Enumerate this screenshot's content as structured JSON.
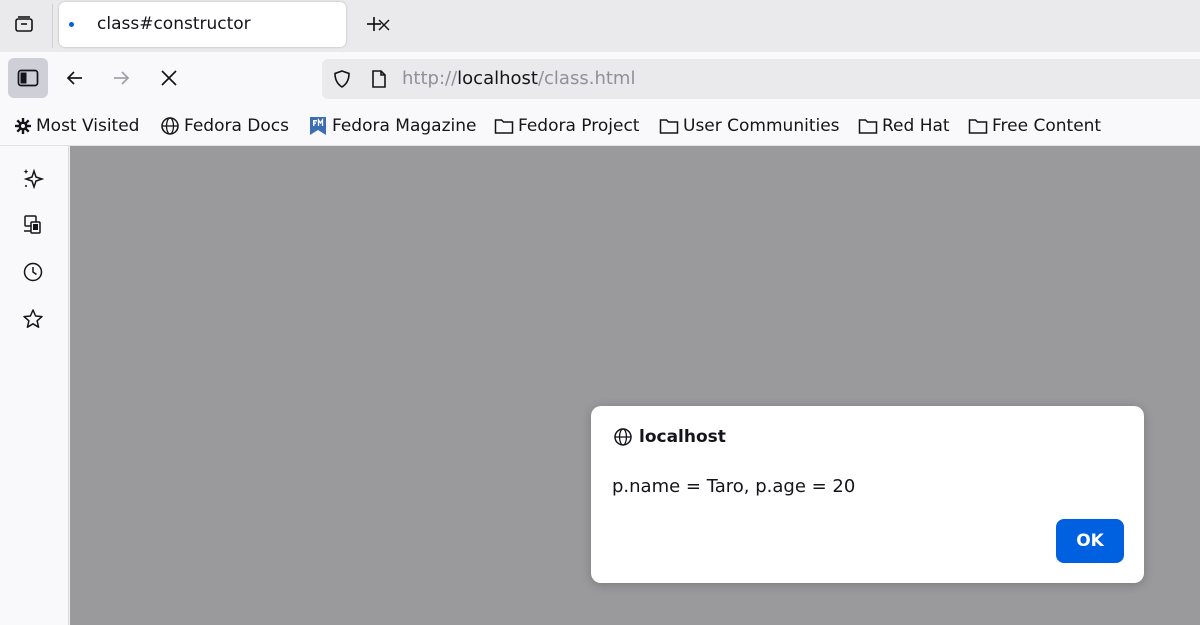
{
  "tabs": [
    {
      "title": "class#constructor",
      "loading": true
    }
  ],
  "address_bar": {
    "scheme": "http://",
    "host": "localhost",
    "path": "/class.html"
  },
  "bookmarks": [
    {
      "label": "Most Visited",
      "icon": "gear-icon"
    },
    {
      "label": "Fedora Docs",
      "icon": "globe-icon"
    },
    {
      "label": "Fedora Magazine",
      "icon": "fedora-magazine-icon"
    },
    {
      "label": "Fedora Project",
      "icon": "folder-icon"
    },
    {
      "label": "User Communities",
      "icon": "folder-icon"
    },
    {
      "label": "Red Hat",
      "icon": "folder-icon"
    },
    {
      "label": "Free Content",
      "icon": "folder-icon"
    }
  ],
  "sidebar": {
    "items": [
      {
        "icon": "ai-sparkle-icon"
      },
      {
        "icon": "synced-devices-icon"
      },
      {
        "icon": "history-clock-icon"
      },
      {
        "icon": "bookmarks-star-icon"
      }
    ]
  },
  "dialog": {
    "origin": "localhost",
    "message": "p.name = Taro, p.age = 20",
    "ok_label": "OK"
  },
  "colors": {
    "accent": "#0061e0",
    "page_overlay": "#9a9a9c"
  }
}
